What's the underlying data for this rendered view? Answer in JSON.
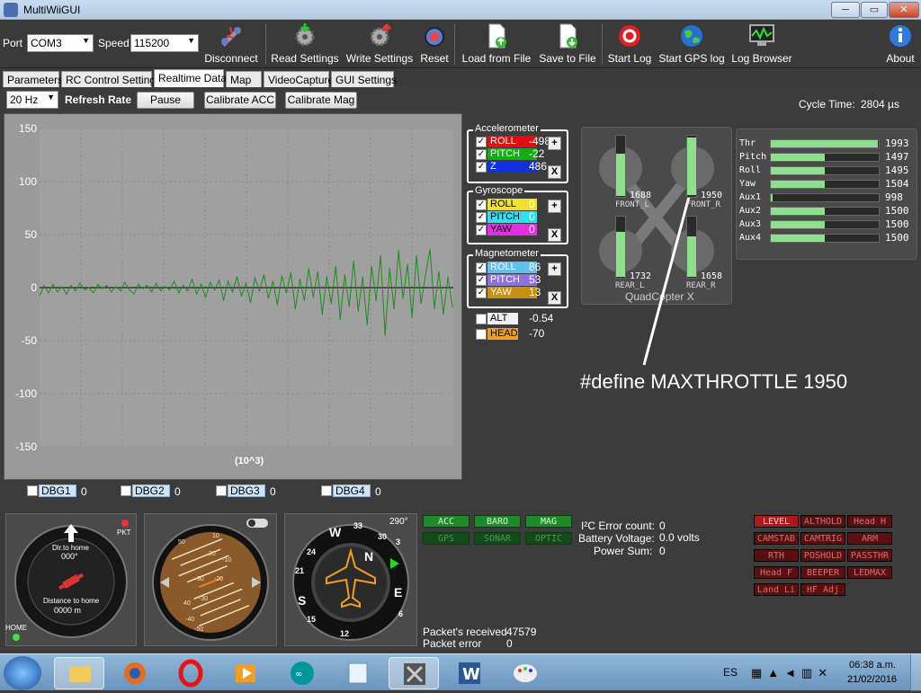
{
  "window": {
    "title": "MultiWiiGUI",
    "min": "─",
    "max": "▭",
    "close": "✕"
  },
  "toolbar": {
    "port_label": "Port",
    "port_value": "COM3",
    "speed_label": "Speed",
    "speed_value": "115200",
    "buttons": [
      "Disconnect",
      "Read Settings",
      "Write Settings",
      "Reset",
      "Load from File",
      "Save to File",
      "Start Log",
      "Start GPS log",
      "Log Browser",
      "About"
    ]
  },
  "tabs": [
    "Parameters",
    "RC Control Settings",
    "Realtime Data",
    "Map",
    "VideoCapture",
    "GUI Settings"
  ],
  "controls": {
    "rate_value": "20 Hz",
    "refresh_label": "Refresh Rate",
    "pause": "Pause",
    "cal_acc": "Calibrate ACC",
    "cal_mag": "Calibrate Mag",
    "cycle_label": "Cycle Time:",
    "cycle_value": "2804 µs"
  },
  "chart_data": {
    "type": "line",
    "xlabel": "(10^3)",
    "ylim": [
      -150,
      150
    ],
    "yticks": [
      "150",
      "100",
      "50",
      "0",
      "-50",
      "-100",
      "-150"
    ],
    "series": [
      {
        "color": "#1e8c1e",
        "values": [
          -8,
          2,
          -5,
          3,
          -4,
          1,
          -6,
          2,
          -3,
          4,
          -2,
          0,
          -5,
          3,
          -1,
          2,
          -4,
          1,
          -3,
          5,
          -2,
          -6,
          3,
          -1,
          2,
          -4,
          4,
          -3,
          1,
          -2,
          6,
          -5,
          2,
          -3,
          8,
          -6,
          3,
          -9,
          5,
          -2,
          7,
          -12,
          6,
          -4,
          10,
          -8,
          4,
          -14,
          9,
          -3,
          12,
          -10,
          6,
          -16,
          11,
          -5,
          14,
          -20,
          8,
          -12,
          18,
          -9,
          15,
          -25,
          10,
          -15,
          20,
          -30,
          12,
          -18,
          25,
          -22,
          10,
          -35,
          20,
          -12,
          30,
          -45,
          18,
          -20,
          35,
          -10,
          22,
          -28,
          30,
          -15,
          12,
          36,
          -20,
          15,
          -25,
          10,
          -18
        ]
      }
    ]
  },
  "sensors": {
    "accel": {
      "title": "Accelerometer",
      "items": [
        {
          "name": "ROLL",
          "value": "-498",
          "color": "#e01010"
        },
        {
          "name": "PITCH",
          "value": "-22",
          "color": "#10b010"
        },
        {
          "name": "Z",
          "value": "486",
          "color": "#1030e0"
        }
      ]
    },
    "gyro": {
      "title": "Gyroscope",
      "items": [
        {
          "name": "ROLL",
          "value": "0",
          "color": "#f0e030"
        },
        {
          "name": "PITCH",
          "value": "0",
          "color": "#30e0f0"
        },
        {
          "name": "YAW",
          "value": "0",
          "color": "#e030e0"
        }
      ]
    },
    "mag": {
      "title": "Magnetometer",
      "items": [
        {
          "name": "ROLL",
          "value": "86",
          "color": "#60c0f0"
        },
        {
          "name": "PITCH",
          "value": "53",
          "color": "#9070e0"
        },
        {
          "name": "YAW",
          "value": "13",
          "color": "#c89010"
        }
      ]
    },
    "alt": {
      "name": "ALT",
      "value": "-0.54",
      "color": "#f0f0f0"
    },
    "head": {
      "name": "HEAD",
      "value": "-70",
      "color": "#f0a020"
    },
    "plus": "+",
    "x": "X",
    "check": "✓"
  },
  "quad": {
    "title": "QuadCopter X",
    "motors": [
      {
        "label": "FRONT_L",
        "value": "1688",
        "level": 0.69
      },
      {
        "label": "FRONT_R",
        "value": "1950",
        "level": 0.95
      },
      {
        "label": "REAR_L",
        "value": "1732",
        "level": 0.73
      },
      {
        "label": "REAR_R",
        "value": "1658",
        "level": 0.66
      }
    ]
  },
  "rc": [
    {
      "name": "Thr",
      "value": "1993",
      "level": 0.99
    },
    {
      "name": "Pitch",
      "value": "1497",
      "level": 0.5
    },
    {
      "name": "Roll",
      "value": "1495",
      "level": 0.5
    },
    {
      "name": "Yaw",
      "value": "1504",
      "level": 0.5
    },
    {
      "name": "Aux1",
      "value": "998",
      "level": 0.0
    },
    {
      "name": "Aux2",
      "value": "1500",
      "level": 0.5
    },
    {
      "name": "Aux3",
      "value": "1500",
      "level": 0.5
    },
    {
      "name": "Aux4",
      "value": "1500",
      "level": 0.5
    }
  ],
  "annotation": "#define MAXTHROTTLE 1950",
  "debug": [
    {
      "name": "DBG1",
      "value": "0"
    },
    {
      "name": "DBG2",
      "value": "0"
    },
    {
      "name": "DBG3",
      "value": "0"
    },
    {
      "name": "DBG4",
      "value": "0"
    }
  ],
  "gps": {
    "pkt": "PKT",
    "dir_label": "Dir.to home",
    "dir_value": "000°",
    "dist_label": "Distance to home",
    "dist_value": "0000  m",
    "home": "HOME"
  },
  "horizon_ticks": [
    "10",
    "20",
    "30",
    "40",
    "-10",
    "-20",
    "-30",
    "-40",
    "-50",
    "50"
  ],
  "compass": {
    "heading": "290°",
    "letters": [
      "W",
      "N",
      "E",
      "S",
      "33",
      "30",
      "24",
      "21",
      "15",
      "12",
      "3",
      "6"
    ]
  },
  "sensor_status": [
    {
      "name": "ACC",
      "on": true
    },
    {
      "name": "BARO",
      "on": true
    },
    {
      "name": "MAG",
      "on": true
    },
    {
      "name": "GPS",
      "on": false
    },
    {
      "name": "SONAR",
      "on": false
    },
    {
      "name": "OPTIC",
      "on": false
    }
  ],
  "stats": {
    "i2c_label": "I²C Error count:",
    "i2c_value": "0",
    "batt_label": "Battery Voltage:",
    "batt_value": "0.0 volts",
    "power_label": "Power Sum:",
    "power_value": "0",
    "pkt_recv_label": "Packet's received",
    "pkt_recv_value": "47579",
    "pkt_err_label": "Packet error",
    "pkt_err_value": "0"
  },
  "modes": [
    {
      "name": "LEVEL",
      "on": true
    },
    {
      "name": "ALTHOLD",
      "on": false
    },
    {
      "name": "Head H",
      "on": false
    },
    {
      "name": "CAMSTAB",
      "on": false
    },
    {
      "name": "CAMTRIG",
      "on": false
    },
    {
      "name": "ARM",
      "on": false
    },
    {
      "name": "RTH",
      "on": false
    },
    {
      "name": "POSHOLD",
      "on": false
    },
    {
      "name": "PASSTHR",
      "on": false
    },
    {
      "name": "Head F",
      "on": false
    },
    {
      "name": "BEEPER",
      "on": false
    },
    {
      "name": "LEDMAX",
      "on": false
    },
    {
      "name": "Land Li",
      "on": false
    },
    {
      "name": "HF Adj",
      "on": false
    }
  ],
  "taskbar": {
    "lang": "ES",
    "time": "06:38 a.m.",
    "date": "21/02/2016"
  }
}
